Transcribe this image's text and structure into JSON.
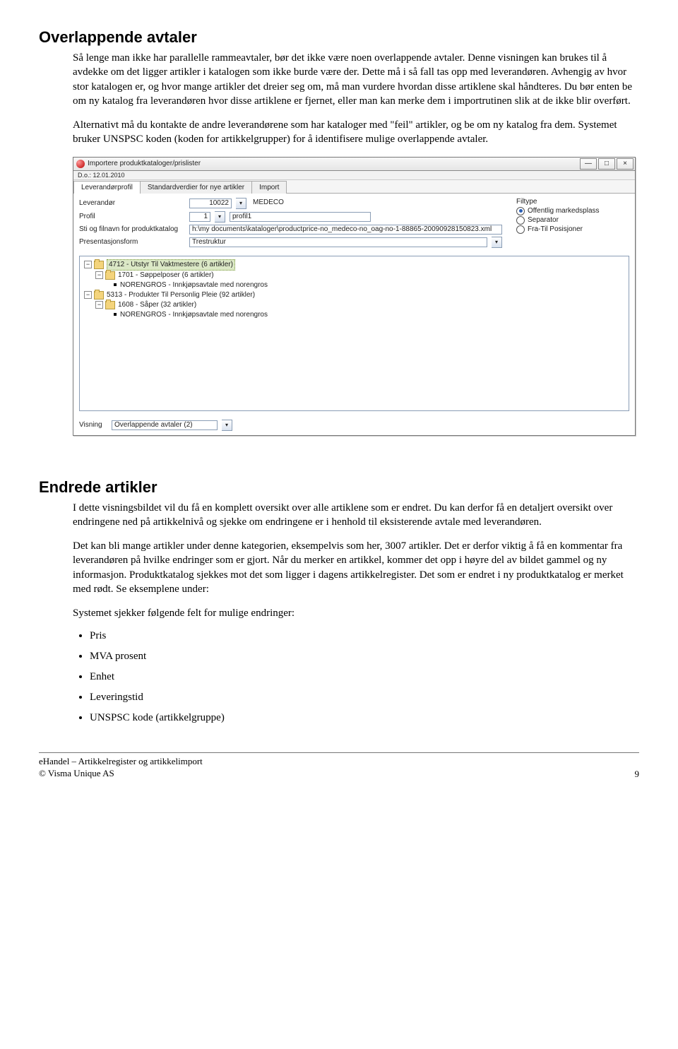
{
  "section1": {
    "heading": "Overlappende avtaler",
    "para1": "Så lenge man ikke har parallelle rammeavtaler, bør det ikke være noen overlappende avtaler. Denne visningen kan brukes til å avdekke om det ligger artikler i katalogen som ikke burde være der. Dette må i så fall tas opp med leverandøren. Avhengig av hvor stor katalogen er, og hvor mange artikler det dreier seg om, må man vurdere hvordan disse artiklene skal håndteres. Du bør enten be om ny katalog fra leverandøren hvor disse artiklene er fjernet, eller man kan merke dem i importrutinen slik at de ikke blir overført.",
    "para2": "Alternativt må du kontakte de andre leverandørene som har kataloger med \"feil\" artikler, og be om ny katalog fra dem. Systemet bruker UNSPSC koden (koden for artikkelgrupper) for å identifisere mulige overlappende avtaler."
  },
  "window": {
    "title": "Importere produktkataloger/prislister",
    "date": "D.o.: 12.01.2010",
    "tabs": [
      "Leverandørprofil",
      "Standardverdier for nye artikler",
      "Import"
    ],
    "labels": {
      "leverandor": "Leverandør",
      "profil": "Profil",
      "sti": "Sti og filnavn for produktkatalog",
      "pres": "Presentasjonsform",
      "visning": "Visning"
    },
    "values": {
      "leverandor_code": "10022",
      "leverandor_name": "MEDECO",
      "profil_code": "1",
      "profil_name": "profil1",
      "sti": "h:\\my documents\\kataloger\\productprice-no_medeco-no_oag-no-1-88865-20090928150823.xml",
      "pres": "Trestruktur",
      "visning": "Overlappende avtaler (2)"
    },
    "filetype": {
      "title": "Filtype",
      "options": [
        "Offentlig markedsplass",
        "Separator",
        "Fra-Til Posisjoner"
      ],
      "selected": 0
    },
    "tree": {
      "n0": "4712 - Utstyr Til Vaktmestere (6 artikler)",
      "n1": "1701 - Søppelposer (6 artikler)",
      "n2": "NORENGROS - Innkjøpsavtale med norengros",
      "n3": "5313 - Produkter Til Personlig Pleie (92 artikler)",
      "n4": "1608 - Såper (32 artikler)",
      "n5": "NORENGROS - Innkjøpsavtale med norengros"
    },
    "winbtns": {
      "min": "—",
      "max": "□",
      "close": "×"
    }
  },
  "section2": {
    "heading": "Endrede artikler",
    "para1": "I dette visningsbildet vil du få en komplett oversikt over alle artiklene som er endret. Du kan derfor få en detaljert oversikt over endringene ned på artikkelnivå og sjekke om endringene er i henhold til eksisterende avtale med leverandøren.",
    "para2": "Det kan bli mange artikler under denne kategorien, eksempelvis som her, 3007 artikler. Det er derfor viktig å få en kommentar fra leverandøren på hvilke endringer som er gjort. Når du merker en artikkel, kommer det opp i høyre del av bildet gammel og ny informasjon. Produktkatalog sjekkes mot det som ligger i dagens artikkelregister. Det som er endret i ny produktkatalog er merket med rødt. Se eksemplene under:",
    "para3": "Systemet sjekker følgende felt for mulige endringer:",
    "bullets": [
      "Pris",
      "MVA prosent",
      "Enhet",
      "Leveringstid",
      "UNSPSC kode (artikkelgruppe)"
    ]
  },
  "footer": {
    "line1": "eHandel – Artikkelregister og artikkelimport",
    "line2": "© Visma Unique AS",
    "page": "9"
  }
}
